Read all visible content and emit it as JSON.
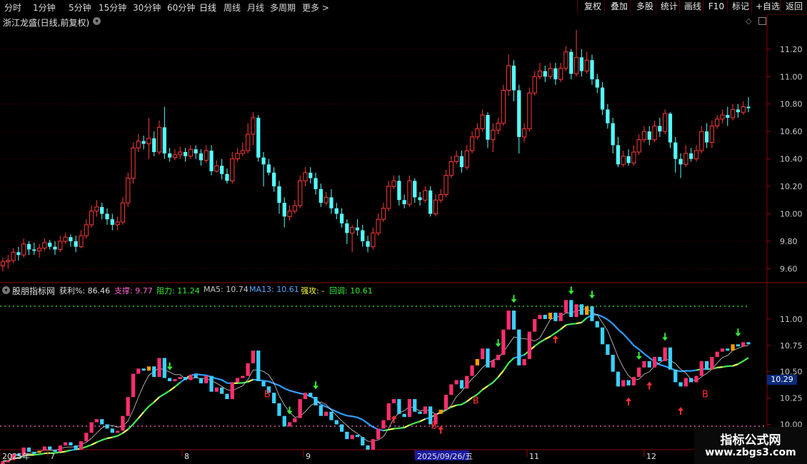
{
  "toolbar": {
    "timeframes": [
      "分时",
      "1分钟",
      "5分钟",
      "15分钟",
      "30分钟",
      "60分钟",
      "日线",
      "周线",
      "月线",
      "多周期",
      "更多 >"
    ],
    "active_timeframe": "日线",
    "buttons": [
      "复权",
      "叠加",
      "多股",
      "统计",
      "画线",
      "F10",
      "标记",
      "+自选",
      "返回"
    ]
  },
  "main_chart": {
    "title": "浙江龙盛(日线,前复权)",
    "price_axis": [
      "11.20",
      "11.00",
      "10.80",
      "10.60",
      "10.40",
      "10.20",
      "10.00",
      "9.80",
      "9.60"
    ],
    "up_color": "#ff3a3a",
    "down_color": "#54ffff"
  },
  "indicator": {
    "name": "股朋指标网",
    "values": [
      {
        "label": "获利%: 86.46",
        "color": "#e0e0e0"
      },
      {
        "label": "支撑: 9.77",
        "color": "#ff66cc"
      },
      {
        "label": "阻力: 11.24",
        "color": "#33ee33"
      },
      {
        "label": "MA5: 10.74",
        "color": "#c8c8c8"
      },
      {
        "label": "MA13: 10.61",
        "color": "#55a8ff"
      },
      {
        "label": "强攻: -",
        "color": "#ffff33"
      },
      {
        "label": "回调: 10.61",
        "color": "#33ee33"
      }
    ],
    "axis": [
      "11.00",
      "10.75",
      "10.50",
      "10.25",
      "10.00"
    ],
    "current_value": "10.29",
    "buy_marker": "B"
  },
  "date_axis": {
    "labels": [
      "2025年",
      "7",
      "8",
      "9",
      "2025/09/26/五",
      "11",
      "12"
    ],
    "highlight": "2025/09/26/五"
  },
  "watermark": {
    "line1": "指标公式网",
    "line2": "www.zbgs3.com"
  },
  "chart_data": {
    "type": "candlestick",
    "title": "浙江龙盛(日线,前复权)",
    "ylim": [
      9.55,
      11.35
    ],
    "candles": [
      [
        9.62,
        9.65,
        9.58,
        9.68
      ],
      [
        9.65,
        9.66,
        9.6,
        9.7
      ],
      [
        9.66,
        9.72,
        9.64,
        9.75
      ],
      [
        9.72,
        9.7,
        9.66,
        9.76
      ],
      [
        9.7,
        9.78,
        9.68,
        9.82
      ],
      [
        9.78,
        9.74,
        9.7,
        9.8
      ],
      [
        9.74,
        9.73,
        9.7,
        9.79
      ],
      [
        9.73,
        9.75,
        9.68,
        9.78
      ],
      [
        9.75,
        9.79,
        9.73,
        9.82
      ],
      [
        9.79,
        9.76,
        9.74,
        9.81
      ],
      [
        9.76,
        9.74,
        9.7,
        9.8
      ],
      [
        9.74,
        9.8,
        9.72,
        9.84
      ],
      [
        9.8,
        9.83,
        9.78,
        9.86
      ],
      [
        9.83,
        9.8,
        9.76,
        9.85
      ],
      [
        9.8,
        9.76,
        9.72,
        9.84
      ],
      [
        9.76,
        9.84,
        9.75,
        9.88
      ],
      [
        9.84,
        9.92,
        9.82,
        9.96
      ],
      [
        9.92,
        10.02,
        9.9,
        10.06
      ],
      [
        10.02,
        10.05,
        9.98,
        10.1
      ],
      [
        10.05,
        10.0,
        9.96,
        10.08
      ],
      [
        10.0,
        9.96,
        9.92,
        10.04
      ],
      [
        9.96,
        9.92,
        9.88,
        10.0
      ],
      [
        9.92,
        9.94,
        9.88,
        9.98
      ],
      [
        9.94,
        10.08,
        9.92,
        10.12
      ],
      [
        10.08,
        10.26,
        10.05,
        10.3
      ],
      [
        10.26,
        10.48,
        10.22,
        10.52
      ],
      [
        10.48,
        10.53,
        10.45,
        10.58
      ],
      [
        10.53,
        10.51,
        10.47,
        10.57
      ],
      [
        10.51,
        10.55,
        10.4,
        10.7
      ],
      [
        10.55,
        10.45,
        10.42,
        10.6
      ],
      [
        10.45,
        10.63,
        10.43,
        10.68
      ],
      [
        10.63,
        10.44,
        10.4,
        10.78
      ],
      [
        10.44,
        10.41,
        10.38,
        10.48
      ],
      [
        10.41,
        10.43,
        10.39,
        10.47
      ],
      [
        10.43,
        10.45,
        10.4,
        10.49
      ],
      [
        10.45,
        10.42,
        10.38,
        10.48
      ],
      [
        10.42,
        10.47,
        10.4,
        10.5
      ],
      [
        10.47,
        10.44,
        10.4,
        10.5
      ],
      [
        10.44,
        10.39,
        10.35,
        10.47
      ],
      [
        10.39,
        10.46,
        10.37,
        10.5
      ],
      [
        10.46,
        10.31,
        10.28,
        10.5
      ],
      [
        10.31,
        10.35,
        10.3,
        10.39
      ],
      [
        10.35,
        10.29,
        10.25,
        10.4
      ],
      [
        10.29,
        10.24,
        10.22,
        10.33
      ],
      [
        10.24,
        10.4,
        10.22,
        10.45
      ],
      [
        10.4,
        10.44,
        10.38,
        10.48
      ],
      [
        10.44,
        10.46,
        10.42,
        10.52
      ],
      [
        10.46,
        10.58,
        10.44,
        10.66
      ],
      [
        10.58,
        10.7,
        10.5,
        10.74
      ],
      [
        10.7,
        10.41,
        10.38,
        10.72
      ],
      [
        10.41,
        10.36,
        10.2,
        10.45
      ],
      [
        10.36,
        10.3,
        10.28,
        10.4
      ],
      [
        10.3,
        10.2,
        10.16,
        10.34
      ],
      [
        10.2,
        10.08,
        10.0,
        10.24
      ],
      [
        10.08,
        9.98,
        9.9,
        10.12
      ],
      [
        9.98,
        10.02,
        9.95,
        10.06
      ],
      [
        10.02,
        10.06,
        10.0,
        10.1
      ],
      [
        10.06,
        10.24,
        10.04,
        10.28
      ],
      [
        10.24,
        10.3,
        10.2,
        10.34
      ],
      [
        10.3,
        10.26,
        10.22,
        10.34
      ],
      [
        10.26,
        10.18,
        10.14,
        10.3
      ],
      [
        10.18,
        10.08,
        10.05,
        10.22
      ],
      [
        10.08,
        10.12,
        10.06,
        10.16
      ],
      [
        10.12,
        10.04,
        10.0,
        10.18
      ],
      [
        10.04,
        10.0,
        9.96,
        10.08
      ],
      [
        10.0,
        9.93,
        9.9,
        10.04
      ],
      [
        9.93,
        9.86,
        9.78,
        9.96
      ],
      [
        9.86,
        9.9,
        9.72,
        9.92
      ],
      [
        9.9,
        9.88,
        9.84,
        9.96
      ],
      [
        9.88,
        9.8,
        9.76,
        9.92
      ],
      [
        9.8,
        9.76,
        9.72,
        9.84
      ],
      [
        9.76,
        9.86,
        9.74,
        9.9
      ],
      [
        9.86,
        9.96,
        9.84,
        10.0
      ],
      [
        9.96,
        10.04,
        9.94,
        10.08
      ],
      [
        10.04,
        10.2,
        10.02,
        10.24
      ],
      [
        10.2,
        10.24,
        10.18,
        10.28
      ],
      [
        10.24,
        10.1,
        10.06,
        10.28
      ],
      [
        10.1,
        10.07,
        10.04,
        10.14
      ],
      [
        10.07,
        10.24,
        10.05,
        10.28
      ],
      [
        10.24,
        10.12,
        10.08,
        10.26
      ],
      [
        10.12,
        10.1,
        10.06,
        10.16
      ],
      [
        10.1,
        10.17,
        10.08,
        10.2
      ],
      [
        10.17,
        10.0,
        9.98,
        10.2
      ],
      [
        10.0,
        10.1,
        9.98,
        10.14
      ],
      [
        10.1,
        10.14,
        10.08,
        10.18
      ],
      [
        10.14,
        10.28,
        10.12,
        10.32
      ],
      [
        10.28,
        10.38,
        10.26,
        10.42
      ],
      [
        10.38,
        10.42,
        10.36,
        10.46
      ],
      [
        10.42,
        10.34,
        10.3,
        10.46
      ],
      [
        10.34,
        10.46,
        10.32,
        10.5
      ],
      [
        10.46,
        10.56,
        10.44,
        10.6
      ],
      [
        10.56,
        10.62,
        10.54,
        10.66
      ],
      [
        10.62,
        10.72,
        10.6,
        10.76
      ],
      [
        10.72,
        10.54,
        10.48,
        10.74
      ],
      [
        10.54,
        10.61,
        10.45,
        10.66
      ],
      [
        10.61,
        10.66,
        10.58,
        10.7
      ],
      [
        10.66,
        10.9,
        10.64,
        10.94
      ],
      [
        10.9,
        11.08,
        10.86,
        11.16
      ],
      [
        11.08,
        10.9,
        10.82,
        11.12
      ],
      [
        10.9,
        10.56,
        10.44,
        10.94
      ],
      [
        10.56,
        10.62,
        10.52,
        10.66
      ],
      [
        10.62,
        10.88,
        10.6,
        10.92
      ],
      [
        10.88,
        11.0,
        10.86,
        11.04
      ],
      [
        11.0,
        11.04,
        10.98,
        11.1
      ],
      [
        11.04,
        11.0,
        10.96,
        11.08
      ],
      [
        11.0,
        11.06,
        10.98,
        11.1
      ],
      [
        11.06,
        10.98,
        10.94,
        11.1
      ],
      [
        10.98,
        11.06,
        10.96,
        11.1
      ],
      [
        11.06,
        11.18,
        11.04,
        11.22
      ],
      [
        11.18,
        11.02,
        10.98,
        11.2
      ],
      [
        11.02,
        11.14,
        11.0,
        11.34
      ],
      [
        11.14,
        11.04,
        11.0,
        11.2
      ],
      [
        11.04,
        11.12,
        11.02,
        11.18
      ],
      [
        11.12,
        10.98,
        10.94,
        11.16
      ],
      [
        10.98,
        10.92,
        10.88,
        11.02
      ],
      [
        10.92,
        10.76,
        10.72,
        10.96
      ],
      [
        10.76,
        10.66,
        10.62,
        10.8
      ],
      [
        10.66,
        10.5,
        10.44,
        10.7
      ],
      [
        10.5,
        10.36,
        10.34,
        10.56
      ],
      [
        10.36,
        10.42,
        10.34,
        10.46
      ],
      [
        10.42,
        10.37,
        10.35,
        10.47
      ],
      [
        10.37,
        10.45,
        10.35,
        10.5
      ],
      [
        10.45,
        10.54,
        10.43,
        10.58
      ],
      [
        10.54,
        10.6,
        10.52,
        10.64
      ],
      [
        10.6,
        10.54,
        10.5,
        10.64
      ],
      [
        10.54,
        10.64,
        10.52,
        10.68
      ],
      [
        10.64,
        10.6,
        10.56,
        10.7
      ],
      [
        10.6,
        10.73,
        10.58,
        10.76
      ],
      [
        10.73,
        10.52,
        10.48,
        10.74
      ],
      [
        10.52,
        10.4,
        10.3,
        10.56
      ],
      [
        10.4,
        10.36,
        10.26,
        10.44
      ],
      [
        10.36,
        10.44,
        10.34,
        10.5
      ],
      [
        10.44,
        10.4,
        10.38,
        10.48
      ],
      [
        10.4,
        10.46,
        10.38,
        10.5
      ],
      [
        10.46,
        10.6,
        10.44,
        10.64
      ],
      [
        10.6,
        10.52,
        10.48,
        10.66
      ],
      [
        10.52,
        10.64,
        10.48,
        10.68
      ],
      [
        10.64,
        10.69,
        10.62,
        10.72
      ],
      [
        10.69,
        10.72,
        10.66,
        10.76
      ],
      [
        10.72,
        10.7,
        10.64,
        10.78
      ],
      [
        10.7,
        10.76,
        10.68,
        10.8
      ],
      [
        10.76,
        10.74,
        10.7,
        10.8
      ],
      [
        10.74,
        10.78,
        10.72,
        10.82
      ],
      [
        10.78,
        10.77,
        10.74,
        10.85
      ]
    ]
  }
}
